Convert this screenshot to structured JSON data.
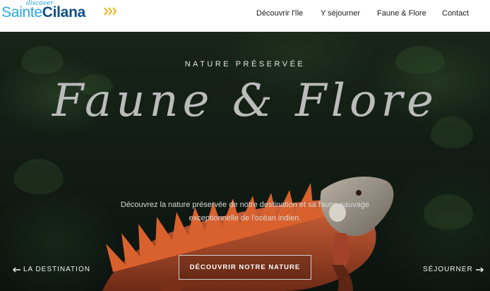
{
  "logo": {
    "small": "discover",
    "sainte": "Sainte",
    "cilana": "Cilana"
  },
  "nav": {
    "items": [
      "Découvrir l'île",
      "Y séjourner",
      "Faune & Flore",
      "Contact"
    ]
  },
  "hero": {
    "kicker": "NATURE PRÉSERVÉE",
    "title": "Faune & Flore",
    "description": "Découvrez la nature préservée de notre destination et sa faune sauvage exceptionnelle de l'océan indien.",
    "cta": "DÉCOUVRIR NOTRE NATURE",
    "prev_link": "LA DESTINATION",
    "next_link": "SÉJOURNER"
  },
  "colors": {
    "logo_light": "#2aa7df",
    "logo_dark": "#0d4f8b",
    "chevrons": "#f2b01e",
    "iguana": "#c4532b"
  },
  "icons": [
    "chevrons-icon",
    "arrow-left-icon",
    "arrow-right-icon"
  ]
}
